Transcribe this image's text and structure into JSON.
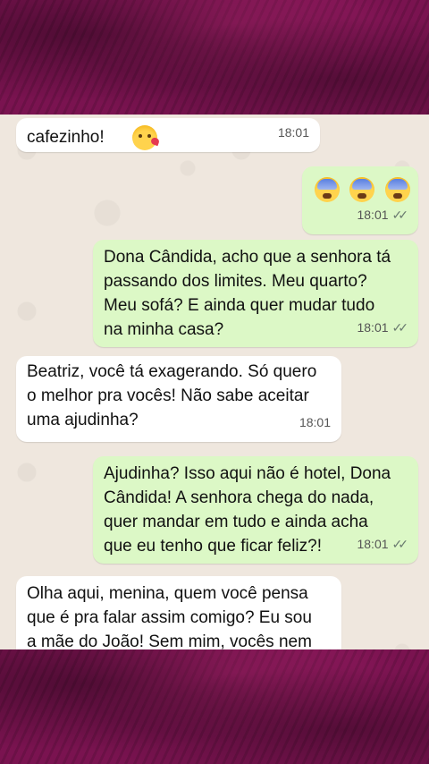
{
  "chat": {
    "messages": [
      {
        "direction": "in",
        "text": "cafezinho! ",
        "emoji": "kissing-heart-emoji",
        "time": "18:01"
      },
      {
        "direction": "out",
        "emoji_row": [
          "fearful-face-emoji",
          "fearful-face-emoji",
          "fearful-face-emoji"
        ],
        "time": "18:01",
        "status": "read"
      },
      {
        "direction": "out",
        "text": "Dona Cândida, acho que a senhora tá\npassando dos limites. Meu quarto?\nMeu sofá? E ainda quer mudar tudo\nna minha casa?",
        "time": "18:01",
        "status": "read"
      },
      {
        "direction": "in",
        "text": "Beatriz, você tá exagerando. Só quero\no melhor pra vocês! Não sabe aceitar\numa ajudinha?",
        "time": "18:01"
      },
      {
        "direction": "out",
        "text": "Ajudinha? Isso aqui não é hotel, Dona\nCândida! A senhora chega do nada,\nquer mandar em tudo e ainda acha\nque eu tenho que ficar feliz?!",
        "time": "18:01",
        "status": "read"
      },
      {
        "direction": "in",
        "text": "Olha aqui, menina, quem você pensa\nque é pra falar assim comigo? Eu sou\na mãe do João! Sem mim, vocês nem"
      }
    ]
  },
  "colors": {
    "frame": "#7a1350",
    "chat_background": "#efe7de",
    "incoming_bubble": "#ffffff",
    "outgoing_bubble": "#dcf8c6"
  }
}
